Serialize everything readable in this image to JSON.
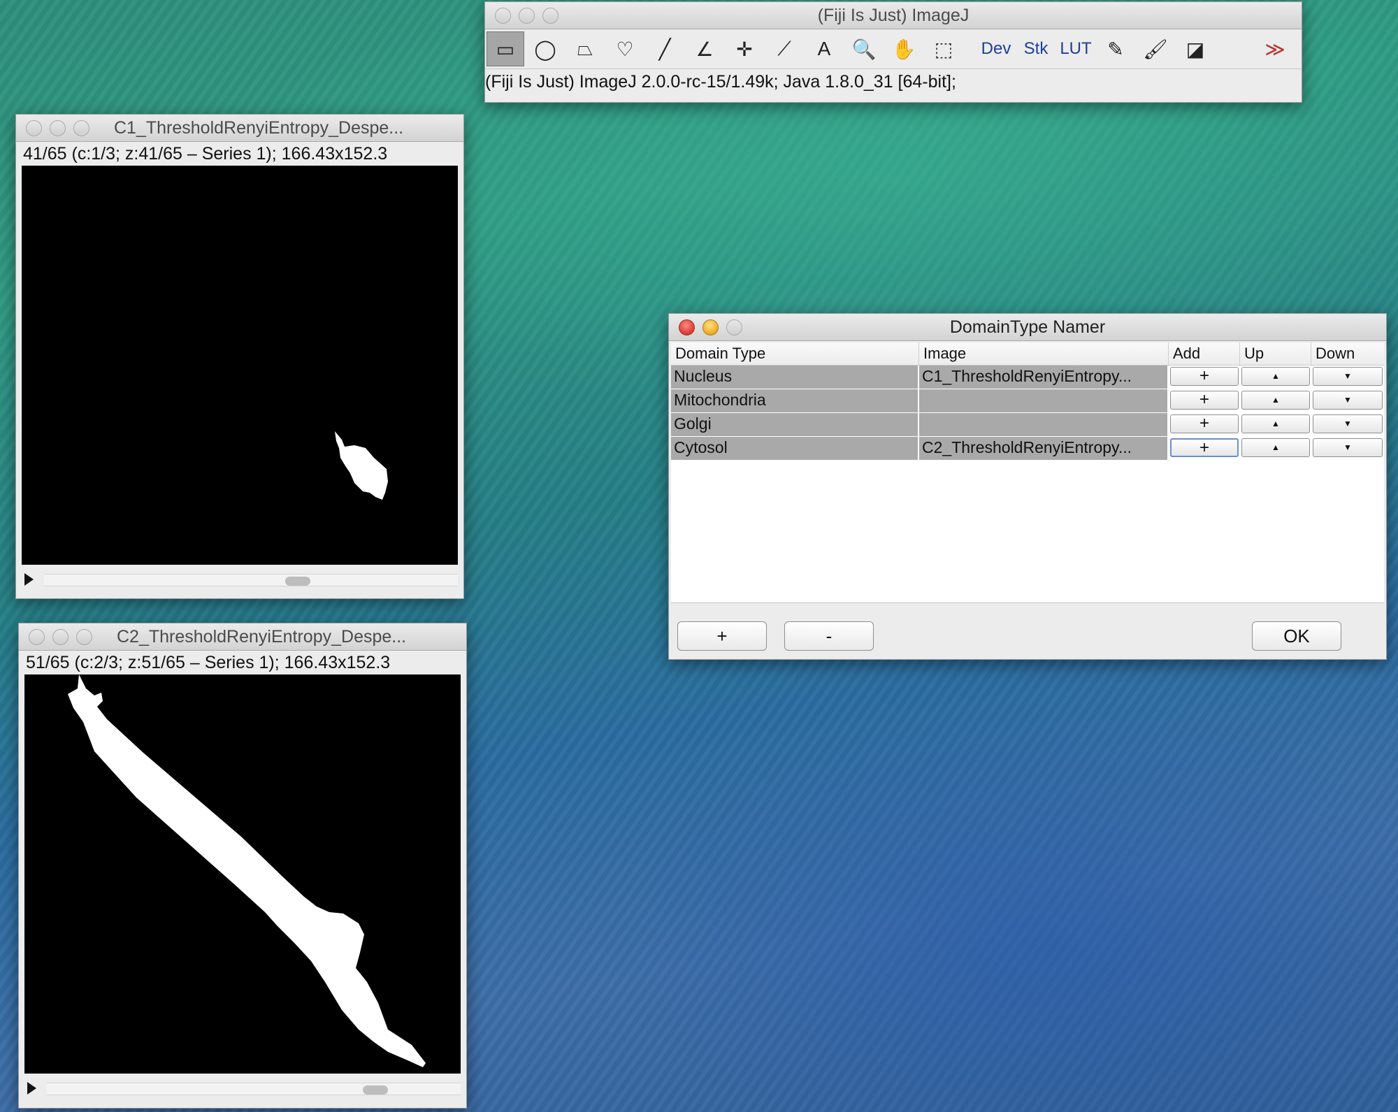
{
  "imagej": {
    "title": "(Fiji Is Just) ImageJ",
    "status": "(Fiji Is Just) ImageJ 2.0.0-rc-15/1.49k; Java 1.8.0_31 [64-bit];",
    "tools": {
      "rect": "▭",
      "oval": "◯",
      "polygon": "⏢",
      "freehand": "♡",
      "line": "╱",
      "angle": "∠",
      "point": "✛",
      "wand": "⟋",
      "text": "A",
      "magnifier": "🔍",
      "hand": "✋",
      "dropper": "⬚",
      "dev": "Dev",
      "stk": "Stk",
      "lut": "LUT",
      "pencil": "✎",
      "brush": "🖌",
      "flood": "◪",
      "more": "≫"
    }
  },
  "c1": {
    "title": "C1_ThresholdRenyiEntropy_Despe...",
    "info": "41/65 (c:1/3; z:41/65 – Series 1); 166.43x152.3"
  },
  "c2": {
    "title": "C2_ThresholdRenyiEntropy_Despe...",
    "info": "51/65 (c:2/3; z:51/65 – Series 1); 166.43x152.3"
  },
  "namer": {
    "title": "DomainType Namer",
    "headers": {
      "domain": "Domain Type",
      "image": "Image",
      "add": "Add",
      "up": "Up",
      "down": "Down"
    },
    "rows": [
      {
        "domain": "Nucleus",
        "image": "C1_ThresholdRenyiEntropy...",
        "add": "+",
        "up": "▲",
        "down": "▼"
      },
      {
        "domain": "Mitochondria",
        "image": "",
        "add": "+",
        "up": "▲",
        "down": "▼"
      },
      {
        "domain": "Golgi",
        "image": "",
        "add": "+",
        "up": "▲",
        "down": "▼"
      },
      {
        "domain": "Cytosol",
        "image": "C2_ThresholdRenyiEntropy...",
        "add": "+",
        "up": "▲",
        "down": "▼"
      }
    ],
    "add_button": "+",
    "remove_button": "-",
    "ok_button": "OK"
  }
}
